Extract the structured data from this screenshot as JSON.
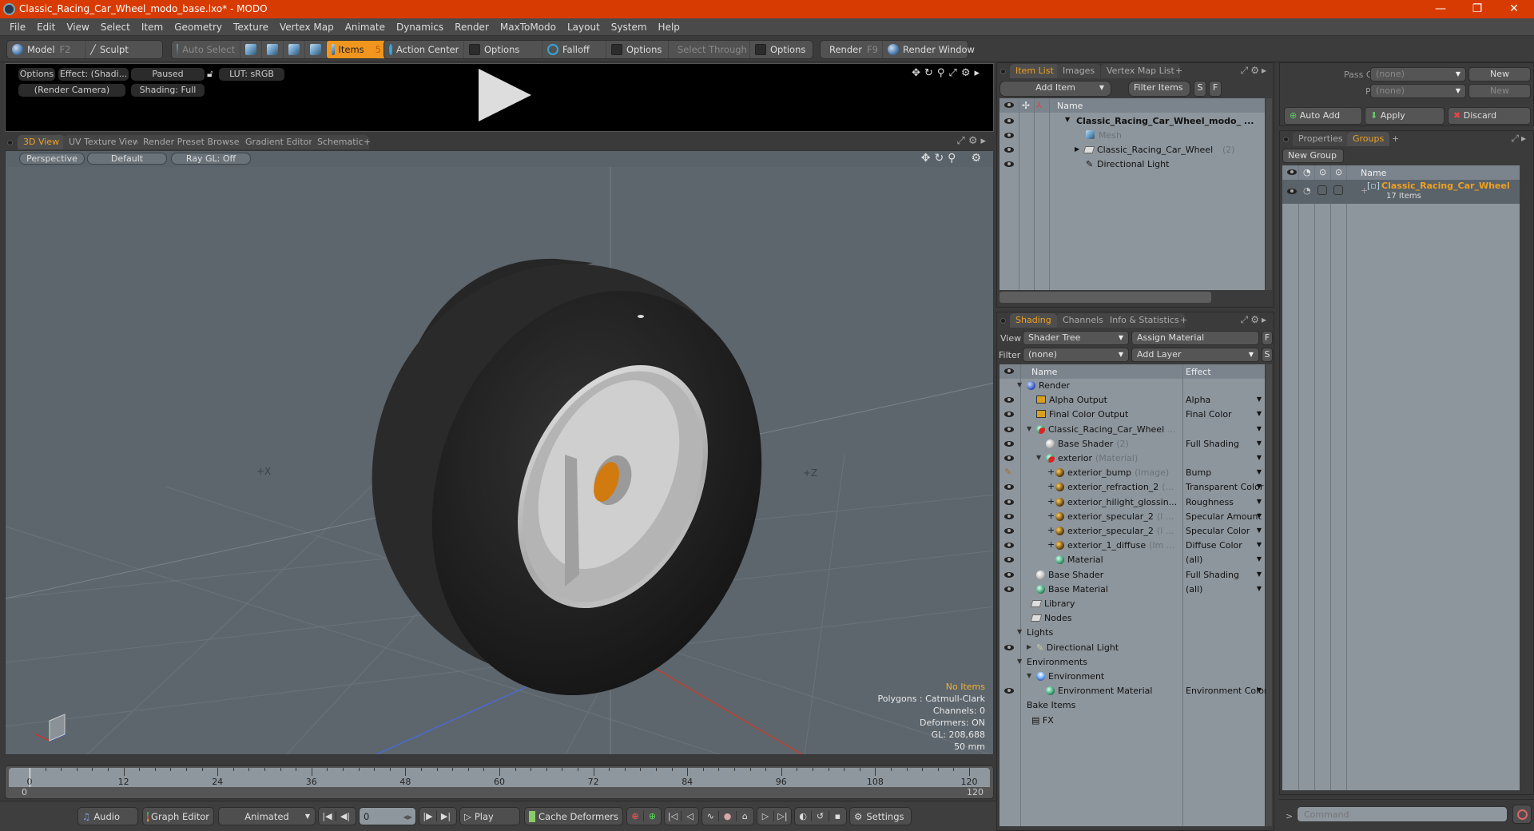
{
  "window": {
    "title": "Classic_Racing_Car_Wheel_modo_base.lxo* - MODO",
    "controls": {
      "minimize": "—",
      "restore": "❐",
      "close": "✕"
    }
  },
  "menu": [
    "File",
    "Edit",
    "View",
    "Select",
    "Item",
    "Geometry",
    "Texture",
    "Vertex Map",
    "Animate",
    "Dynamics",
    "Render",
    "MaxToModo",
    "Layout",
    "System",
    "Help"
  ],
  "toolbar": {
    "model": {
      "label": "Model",
      "key": "F2"
    },
    "sculpt": {
      "label": "Sculpt"
    },
    "auto_select": "Auto Select",
    "items": {
      "label": "Items",
      "key": "5"
    },
    "action_center": "Action Center",
    "options1": "Options",
    "falloff": "Falloff",
    "options2": "Options",
    "select_through": "Select Through",
    "options3": "Options",
    "render": {
      "label": "Render",
      "key": "F9"
    },
    "render_window": "Render Window"
  },
  "render_preview": {
    "options": "Options",
    "effect": "Effect: (Shadi...",
    "status": "Paused",
    "lut": "LUT: sRGB",
    "camera": "(Render Camera)",
    "shading": "Shading: Full"
  },
  "viewport_tabs": [
    "3D View",
    "UV Texture View",
    "Render Preset Browser",
    "Gradient Editor",
    "Schematic",
    "+"
  ],
  "viewport": {
    "view_mode": "Perspective",
    "style": "Default",
    "raygl": "Ray GL: Off",
    "axis_labels": {
      "neg_x": "+X",
      "pos_z": "+Z"
    },
    "stats": {
      "selection": "No Items",
      "polygons": "Polygons : Catmull-Clark",
      "channels": "Channels: 0",
      "deformers": "Deformers: ON",
      "gl": "GL: 208,688",
      "scale": "50 mm"
    },
    "colors": {
      "background": "#5d666d",
      "tire": "#1e1e1e",
      "rim": "#c8c8c8",
      "hub": "#d07a10"
    }
  },
  "timeline": {
    "ticks": [
      0,
      12,
      24,
      36,
      48,
      60,
      72,
      84,
      96,
      108,
      120
    ],
    "range_start": "0",
    "range_end": "120",
    "current_frame": 0
  },
  "bottombar": {
    "audio": "Audio",
    "graph_editor": "Graph Editor",
    "animated": "Animated",
    "frame": "0",
    "play": "Play",
    "cache_deformers": "Cache Deformers",
    "settings": "Settings"
  },
  "item_list": {
    "tabs": [
      "Item List",
      "Images",
      "Vertex Map List",
      "+"
    ],
    "add_item": "Add Item",
    "filter_items": "Filter Items",
    "s_btn": "S",
    "f_btn": "F",
    "name_header": "Name",
    "items": [
      {
        "label": "Classic_Racing_Car_Wheel_modo_ ...",
        "bold": true
      },
      {
        "label": "Mesh",
        "muted": true
      },
      {
        "label": "Classic_Racing_Car_Wheel",
        "count": "(2)"
      },
      {
        "label": "Directional Light"
      }
    ]
  },
  "passes": {
    "pass_groups_label": "Pass Groups",
    "pass_groups_value": "(none)",
    "passes_label": "Passes",
    "passes_value": "(none)",
    "new1": "New",
    "new2": "New",
    "auto_add": "Auto Add",
    "apply": "Apply",
    "discard": "Discard"
  },
  "groups": {
    "tabs": [
      "Properties",
      "Groups",
      "+"
    ],
    "new_group": "New Group",
    "name_header": "Name",
    "group_name": "Classic_Racing_Car_Wheel",
    "group_count": "17 Items"
  },
  "shading": {
    "tabs": [
      "Shading",
      "Channels",
      "Info & Statistics",
      "+"
    ],
    "view_label": "View",
    "view_value": "Shader Tree",
    "assign_material": "Assign Material",
    "f_btn": "F",
    "filter_label": "Filter",
    "filter_value": "(none)",
    "add_layer": "Add Layer",
    "s_btn": "S",
    "name_header": "Name",
    "effect_header": "Effect",
    "rows": [
      {
        "label": "Render",
        "effect": "",
        "eye": false,
        "icon": "blue",
        "indent": 0
      },
      {
        "label": "Alpha Output",
        "effect": "Alpha",
        "eye": true,
        "icon": "img",
        "indent": 1
      },
      {
        "label": "Final Color Output",
        "effect": "Final Color",
        "eye": true,
        "icon": "img",
        "indent": 1
      },
      {
        "label": "Classic_Racing_Car_Wheel",
        "suffix": "...",
        "effect": "",
        "eye": true,
        "icon": "mat",
        "indent": 1
      },
      {
        "label": "Base Shader",
        "suffix": "(2)",
        "effect": "Full Shading",
        "eye": true,
        "icon": "white",
        "indent": 2
      },
      {
        "label": "exterior",
        "suffix": "(Material)",
        "effect": "",
        "eye": true,
        "icon": "mat",
        "indent": 2
      },
      {
        "label": "exterior_bump",
        "suffix": "(Image)",
        "effect": "Bump",
        "eye": "brush",
        "icon": "gold",
        "indent": 3
      },
      {
        "label": "exterior_refraction_2",
        "suffix": "(...",
        "effect": "Transparent Color",
        "eye": true,
        "icon": "gold",
        "indent": 3
      },
      {
        "label": "exterior_hilight_glossin...",
        "suffix": "",
        "effect": "Roughness",
        "eye": true,
        "icon": "gold",
        "indent": 3
      },
      {
        "label": "exterior_specular_2",
        "suffix": "(I ...",
        "effect": "Specular Amount",
        "eye": true,
        "icon": "gold",
        "indent": 3
      },
      {
        "label": "exterior_specular_2",
        "suffix": "(I ...",
        "effect": "Specular Color",
        "eye": true,
        "icon": "gold",
        "indent": 3
      },
      {
        "label": "exterior_1_diffuse",
        "suffix": "(Im ...",
        "effect": "Diffuse Color",
        "eye": true,
        "icon": "gold",
        "indent": 3
      },
      {
        "label": "Material",
        "effect": "(all)",
        "eye": true,
        "icon": "green",
        "indent": 3
      },
      {
        "label": "Base Shader",
        "effect": "Full Shading",
        "eye": true,
        "icon": "white",
        "indent": 1
      },
      {
        "label": "Base Material",
        "effect": "(all)",
        "eye": true,
        "icon": "green",
        "indent": 1
      },
      {
        "label": "Library",
        "effect": "",
        "eye": false,
        "icon": "folder",
        "indent": 0.5
      },
      {
        "label": "Nodes",
        "effect": "",
        "eye": false,
        "icon": "folder",
        "indent": 0.5
      },
      {
        "label": "Lights",
        "effect": "",
        "eye": false,
        "icon": "none",
        "indent": 0
      },
      {
        "label": "Directional Light",
        "effect": "",
        "eye": true,
        "icon": "light",
        "indent": 1
      },
      {
        "label": "Environments",
        "effect": "",
        "eye": false,
        "icon": "none",
        "indent": 0
      },
      {
        "label": "Environment",
        "effect": "",
        "eye": false,
        "icon": "env",
        "indent": 1
      },
      {
        "label": "Environment Material",
        "effect": "Environment Color",
        "eye": true,
        "icon": "green",
        "indent": 2
      },
      {
        "label": "Bake Items",
        "effect": "",
        "eye": false,
        "icon": "none",
        "indent": 0
      },
      {
        "label": "FX",
        "effect": "",
        "eye": false,
        "icon": "clap",
        "indent": 0.5
      }
    ]
  },
  "command": {
    "prompt": ">",
    "placeholder": "Command"
  },
  "accent": "#f0961e"
}
